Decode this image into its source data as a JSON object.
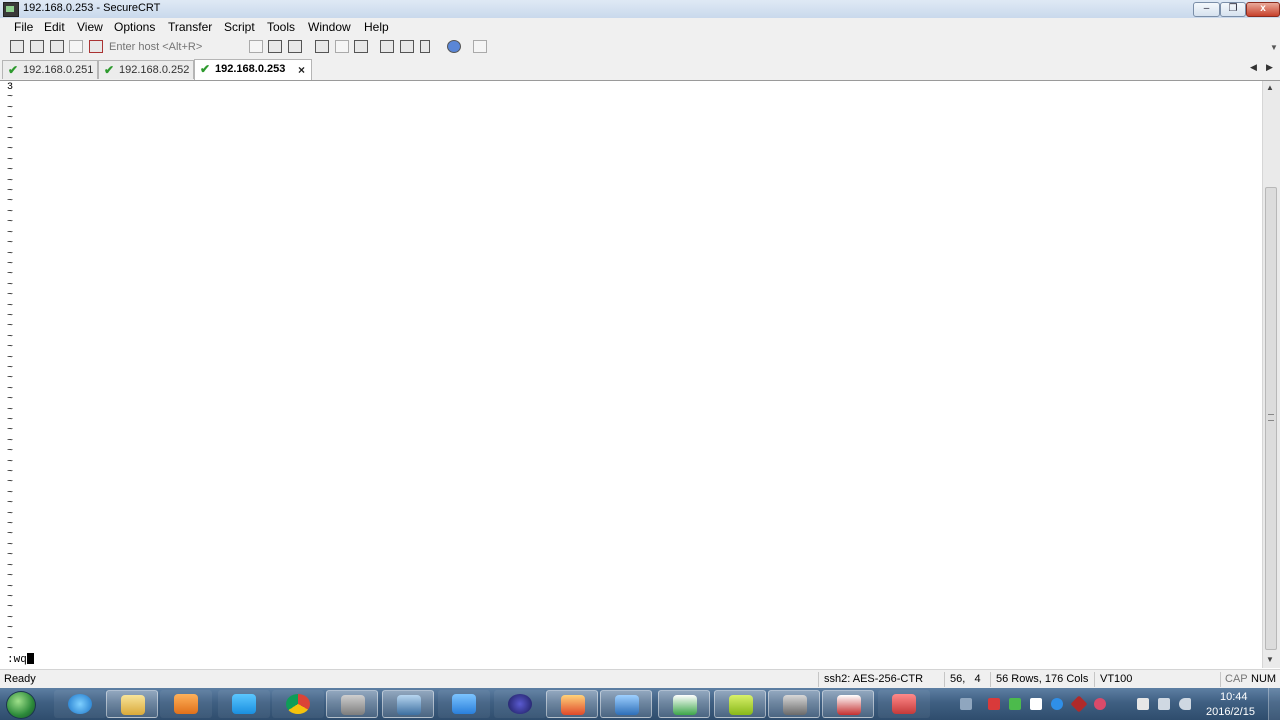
{
  "window": {
    "title": "192.168.0.253 - SecureCRT",
    "min_glyph": "‒",
    "max_glyph": "❐",
    "close_glyph": "x"
  },
  "menu": [
    "File",
    "Edit",
    "View",
    "Options",
    "Transfer",
    "Script",
    "Tools",
    "Window",
    "Help"
  ],
  "toolbar": {
    "host_placeholder": "Enter host <Alt+R>"
  },
  "tabs": [
    {
      "label": "192.168.0.251",
      "active": false
    },
    {
      "label": "192.168.0.252",
      "active": false
    },
    {
      "label": "192.168.0.253",
      "active": true
    }
  ],
  "tab_close_glyph": "×",
  "tab_nav": {
    "left": "◀",
    "right": "▶"
  },
  "terminal": {
    "first_line": "3",
    "empty_line_marker": "~",
    "empty_line_count": 54,
    "command": ":wq"
  },
  "status": {
    "ready": "Ready",
    "cipher": "ssh2: AES-256-CTR",
    "cursor_pos": "56,   4",
    "size": "56 Rows, 176 Cols",
    "emulation": "VT100",
    "cap": "CAP",
    "num": "NUM"
  },
  "taskbar": {
    "time": "10:44",
    "date": "2016/2/15"
  },
  "colors": {
    "tab_check": "#2e9a2e",
    "taskbar": "#3f5f82"
  }
}
